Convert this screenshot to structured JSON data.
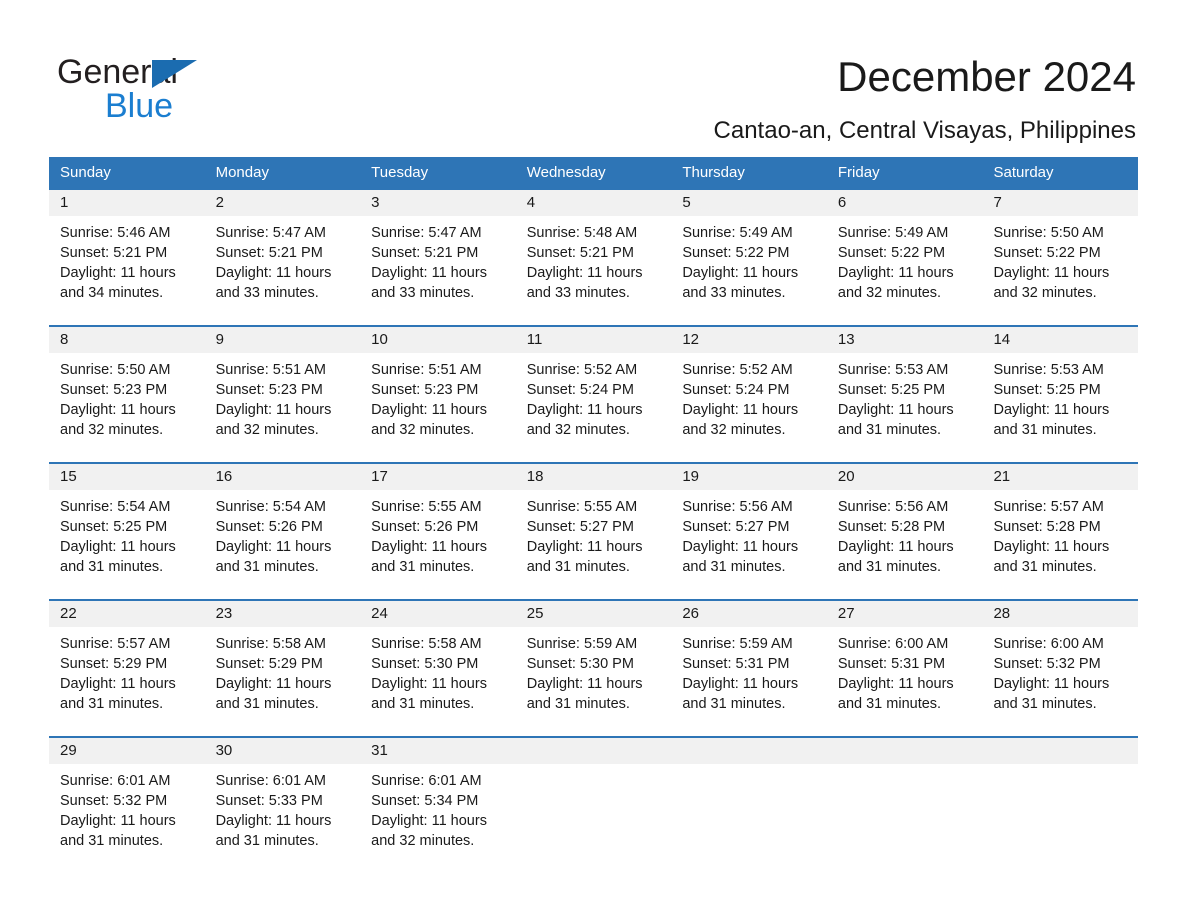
{
  "brand": {
    "name_part1": "General",
    "name_part2": "Blue",
    "accent_color": "#1b7ed0",
    "triangle_color": "#1b6cb0"
  },
  "header": {
    "title": "December 2024",
    "subtitle": "Cantao-an, Central Visayas, Philippines"
  },
  "calendar": {
    "header_color": "#2e75b6",
    "daynum_band_color": "#f1f1f1",
    "weekdays": [
      "Sunday",
      "Monday",
      "Tuesday",
      "Wednesday",
      "Thursday",
      "Friday",
      "Saturday"
    ],
    "weeks": [
      [
        {
          "day": "1",
          "sunrise": "Sunrise: 5:46 AM",
          "sunset": "Sunset: 5:21 PM",
          "daylight1": "Daylight: 11 hours",
          "daylight2": "and 34 minutes."
        },
        {
          "day": "2",
          "sunrise": "Sunrise: 5:47 AM",
          "sunset": "Sunset: 5:21 PM",
          "daylight1": "Daylight: 11 hours",
          "daylight2": "and 33 minutes."
        },
        {
          "day": "3",
          "sunrise": "Sunrise: 5:47 AM",
          "sunset": "Sunset: 5:21 PM",
          "daylight1": "Daylight: 11 hours",
          "daylight2": "and 33 minutes."
        },
        {
          "day": "4",
          "sunrise": "Sunrise: 5:48 AM",
          "sunset": "Sunset: 5:21 PM",
          "daylight1": "Daylight: 11 hours",
          "daylight2": "and 33 minutes."
        },
        {
          "day": "5",
          "sunrise": "Sunrise: 5:49 AM",
          "sunset": "Sunset: 5:22 PM",
          "daylight1": "Daylight: 11 hours",
          "daylight2": "and 33 minutes."
        },
        {
          "day": "6",
          "sunrise": "Sunrise: 5:49 AM",
          "sunset": "Sunset: 5:22 PM",
          "daylight1": "Daylight: 11 hours",
          "daylight2": "and 32 minutes."
        },
        {
          "day": "7",
          "sunrise": "Sunrise: 5:50 AM",
          "sunset": "Sunset: 5:22 PM",
          "daylight1": "Daylight: 11 hours",
          "daylight2": "and 32 minutes."
        }
      ],
      [
        {
          "day": "8",
          "sunrise": "Sunrise: 5:50 AM",
          "sunset": "Sunset: 5:23 PM",
          "daylight1": "Daylight: 11 hours",
          "daylight2": "and 32 minutes."
        },
        {
          "day": "9",
          "sunrise": "Sunrise: 5:51 AM",
          "sunset": "Sunset: 5:23 PM",
          "daylight1": "Daylight: 11 hours",
          "daylight2": "and 32 minutes."
        },
        {
          "day": "10",
          "sunrise": "Sunrise: 5:51 AM",
          "sunset": "Sunset: 5:23 PM",
          "daylight1": "Daylight: 11 hours",
          "daylight2": "and 32 minutes."
        },
        {
          "day": "11",
          "sunrise": "Sunrise: 5:52 AM",
          "sunset": "Sunset: 5:24 PM",
          "daylight1": "Daylight: 11 hours",
          "daylight2": "and 32 minutes."
        },
        {
          "day": "12",
          "sunrise": "Sunrise: 5:52 AM",
          "sunset": "Sunset: 5:24 PM",
          "daylight1": "Daylight: 11 hours",
          "daylight2": "and 32 minutes."
        },
        {
          "day": "13",
          "sunrise": "Sunrise: 5:53 AM",
          "sunset": "Sunset: 5:25 PM",
          "daylight1": "Daylight: 11 hours",
          "daylight2": "and 31 minutes."
        },
        {
          "day": "14",
          "sunrise": "Sunrise: 5:53 AM",
          "sunset": "Sunset: 5:25 PM",
          "daylight1": "Daylight: 11 hours",
          "daylight2": "and 31 minutes."
        }
      ],
      [
        {
          "day": "15",
          "sunrise": "Sunrise: 5:54 AM",
          "sunset": "Sunset: 5:25 PM",
          "daylight1": "Daylight: 11 hours",
          "daylight2": "and 31 minutes."
        },
        {
          "day": "16",
          "sunrise": "Sunrise: 5:54 AM",
          "sunset": "Sunset: 5:26 PM",
          "daylight1": "Daylight: 11 hours",
          "daylight2": "and 31 minutes."
        },
        {
          "day": "17",
          "sunrise": "Sunrise: 5:55 AM",
          "sunset": "Sunset: 5:26 PM",
          "daylight1": "Daylight: 11 hours",
          "daylight2": "and 31 minutes."
        },
        {
          "day": "18",
          "sunrise": "Sunrise: 5:55 AM",
          "sunset": "Sunset: 5:27 PM",
          "daylight1": "Daylight: 11 hours",
          "daylight2": "and 31 minutes."
        },
        {
          "day": "19",
          "sunrise": "Sunrise: 5:56 AM",
          "sunset": "Sunset: 5:27 PM",
          "daylight1": "Daylight: 11 hours",
          "daylight2": "and 31 minutes."
        },
        {
          "day": "20",
          "sunrise": "Sunrise: 5:56 AM",
          "sunset": "Sunset: 5:28 PM",
          "daylight1": "Daylight: 11 hours",
          "daylight2": "and 31 minutes."
        },
        {
          "day": "21",
          "sunrise": "Sunrise: 5:57 AM",
          "sunset": "Sunset: 5:28 PM",
          "daylight1": "Daylight: 11 hours",
          "daylight2": "and 31 minutes."
        }
      ],
      [
        {
          "day": "22",
          "sunrise": "Sunrise: 5:57 AM",
          "sunset": "Sunset: 5:29 PM",
          "daylight1": "Daylight: 11 hours",
          "daylight2": "and 31 minutes."
        },
        {
          "day": "23",
          "sunrise": "Sunrise: 5:58 AM",
          "sunset": "Sunset: 5:29 PM",
          "daylight1": "Daylight: 11 hours",
          "daylight2": "and 31 minutes."
        },
        {
          "day": "24",
          "sunrise": "Sunrise: 5:58 AM",
          "sunset": "Sunset: 5:30 PM",
          "daylight1": "Daylight: 11 hours",
          "daylight2": "and 31 minutes."
        },
        {
          "day": "25",
          "sunrise": "Sunrise: 5:59 AM",
          "sunset": "Sunset: 5:30 PM",
          "daylight1": "Daylight: 11 hours",
          "daylight2": "and 31 minutes."
        },
        {
          "day": "26",
          "sunrise": "Sunrise: 5:59 AM",
          "sunset": "Sunset: 5:31 PM",
          "daylight1": "Daylight: 11 hours",
          "daylight2": "and 31 minutes."
        },
        {
          "day": "27",
          "sunrise": "Sunrise: 6:00 AM",
          "sunset": "Sunset: 5:31 PM",
          "daylight1": "Daylight: 11 hours",
          "daylight2": "and 31 minutes."
        },
        {
          "day": "28",
          "sunrise": "Sunrise: 6:00 AM",
          "sunset": "Sunset: 5:32 PM",
          "daylight1": "Daylight: 11 hours",
          "daylight2": "and 31 minutes."
        }
      ],
      [
        {
          "day": "29",
          "sunrise": "Sunrise: 6:01 AM",
          "sunset": "Sunset: 5:32 PM",
          "daylight1": "Daylight: 11 hours",
          "daylight2": "and 31 minutes."
        },
        {
          "day": "30",
          "sunrise": "Sunrise: 6:01 AM",
          "sunset": "Sunset: 5:33 PM",
          "daylight1": "Daylight: 11 hours",
          "daylight2": "and 31 minutes."
        },
        {
          "day": "31",
          "sunrise": "Sunrise: 6:01 AM",
          "sunset": "Sunset: 5:34 PM",
          "daylight1": "Daylight: 11 hours",
          "daylight2": "and 32 minutes."
        },
        {
          "day": "",
          "sunrise": "",
          "sunset": "",
          "daylight1": "",
          "daylight2": ""
        },
        {
          "day": "",
          "sunrise": "",
          "sunset": "",
          "daylight1": "",
          "daylight2": ""
        },
        {
          "day": "",
          "sunrise": "",
          "sunset": "",
          "daylight1": "",
          "daylight2": ""
        },
        {
          "day": "",
          "sunrise": "",
          "sunset": "",
          "daylight1": "",
          "daylight2": ""
        }
      ]
    ]
  }
}
